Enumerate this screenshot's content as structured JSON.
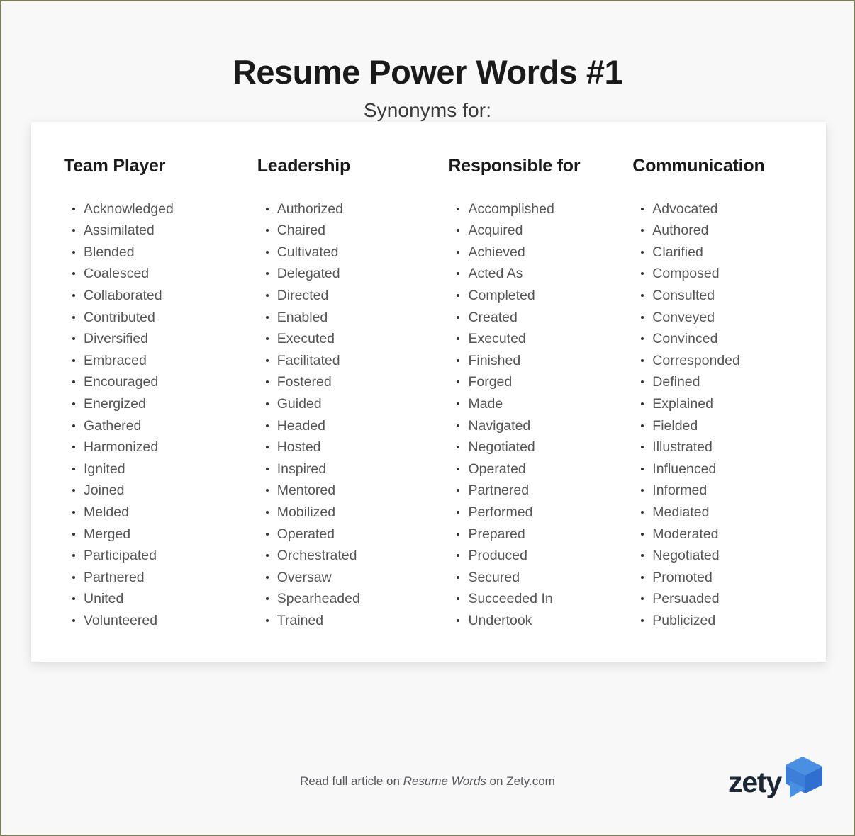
{
  "header": {
    "title": "Resume Power Words #1",
    "subtitle": "Synonyms for:"
  },
  "columns": [
    {
      "heading": "Team Player",
      "items": [
        "Acknowledged",
        "Assimilated",
        "Blended",
        "Coalesced",
        "Collaborated",
        "Contributed",
        "Diversified",
        "Embraced",
        "Encouraged",
        "Energized",
        "Gathered",
        "Harmonized",
        "Ignited",
        "Joined",
        "Melded",
        "Merged",
        "Participated",
        "Partnered",
        "United",
        "Volunteered"
      ]
    },
    {
      "heading": "Leadership",
      "items": [
        "Authorized",
        "Chaired",
        "Cultivated",
        "Delegated",
        "Directed",
        "Enabled",
        "Executed",
        "Facilitated",
        "Fostered",
        "Guided",
        "Headed",
        "Hosted",
        "Inspired",
        "Mentored",
        "Mobilized",
        "Operated",
        "Orchestrated",
        "Oversaw",
        "Spearheaded",
        "Trained"
      ]
    },
    {
      "heading": "Responsible for",
      "items": [
        "Accomplished",
        "Acquired",
        "Achieved",
        "Acted As",
        "Completed",
        "Created",
        "Executed",
        "Finished",
        "Forged",
        "Made",
        "Navigated",
        "Negotiated",
        "Operated",
        "Partnered",
        "Performed",
        "Prepared",
        "Produced",
        "Secured",
        "Succeeded In",
        "Undertook"
      ]
    },
    {
      "heading": "Communication",
      "items": [
        "Advocated",
        "Authored",
        "Clarified",
        "Composed",
        "Consulted",
        "Conveyed",
        "Convinced",
        "Corresponded",
        "Defined",
        "Explained",
        "Fielded",
        "Illustrated",
        "Influenced",
        "Informed",
        "Mediated",
        "Moderated",
        "Negotiated",
        "Promoted",
        "Persuaded",
        "Publicized"
      ]
    }
  ],
  "footer": {
    "note_prefix": "Read full article on ",
    "note_emphasis": "Resume Words",
    "note_suffix": " on Zety.com",
    "logo_text": "zety",
    "logo_icon": "zety-arrow-logo",
    "logo_color_light": "#4a90e2",
    "logo_color_dark": "#2f6fd0"
  },
  "colors": {
    "page_background": "#f8f8f9",
    "card_background": "#ffffff",
    "heading_text": "#1a1a1a",
    "body_text": "#555558",
    "border": "#7d7d5e"
  }
}
